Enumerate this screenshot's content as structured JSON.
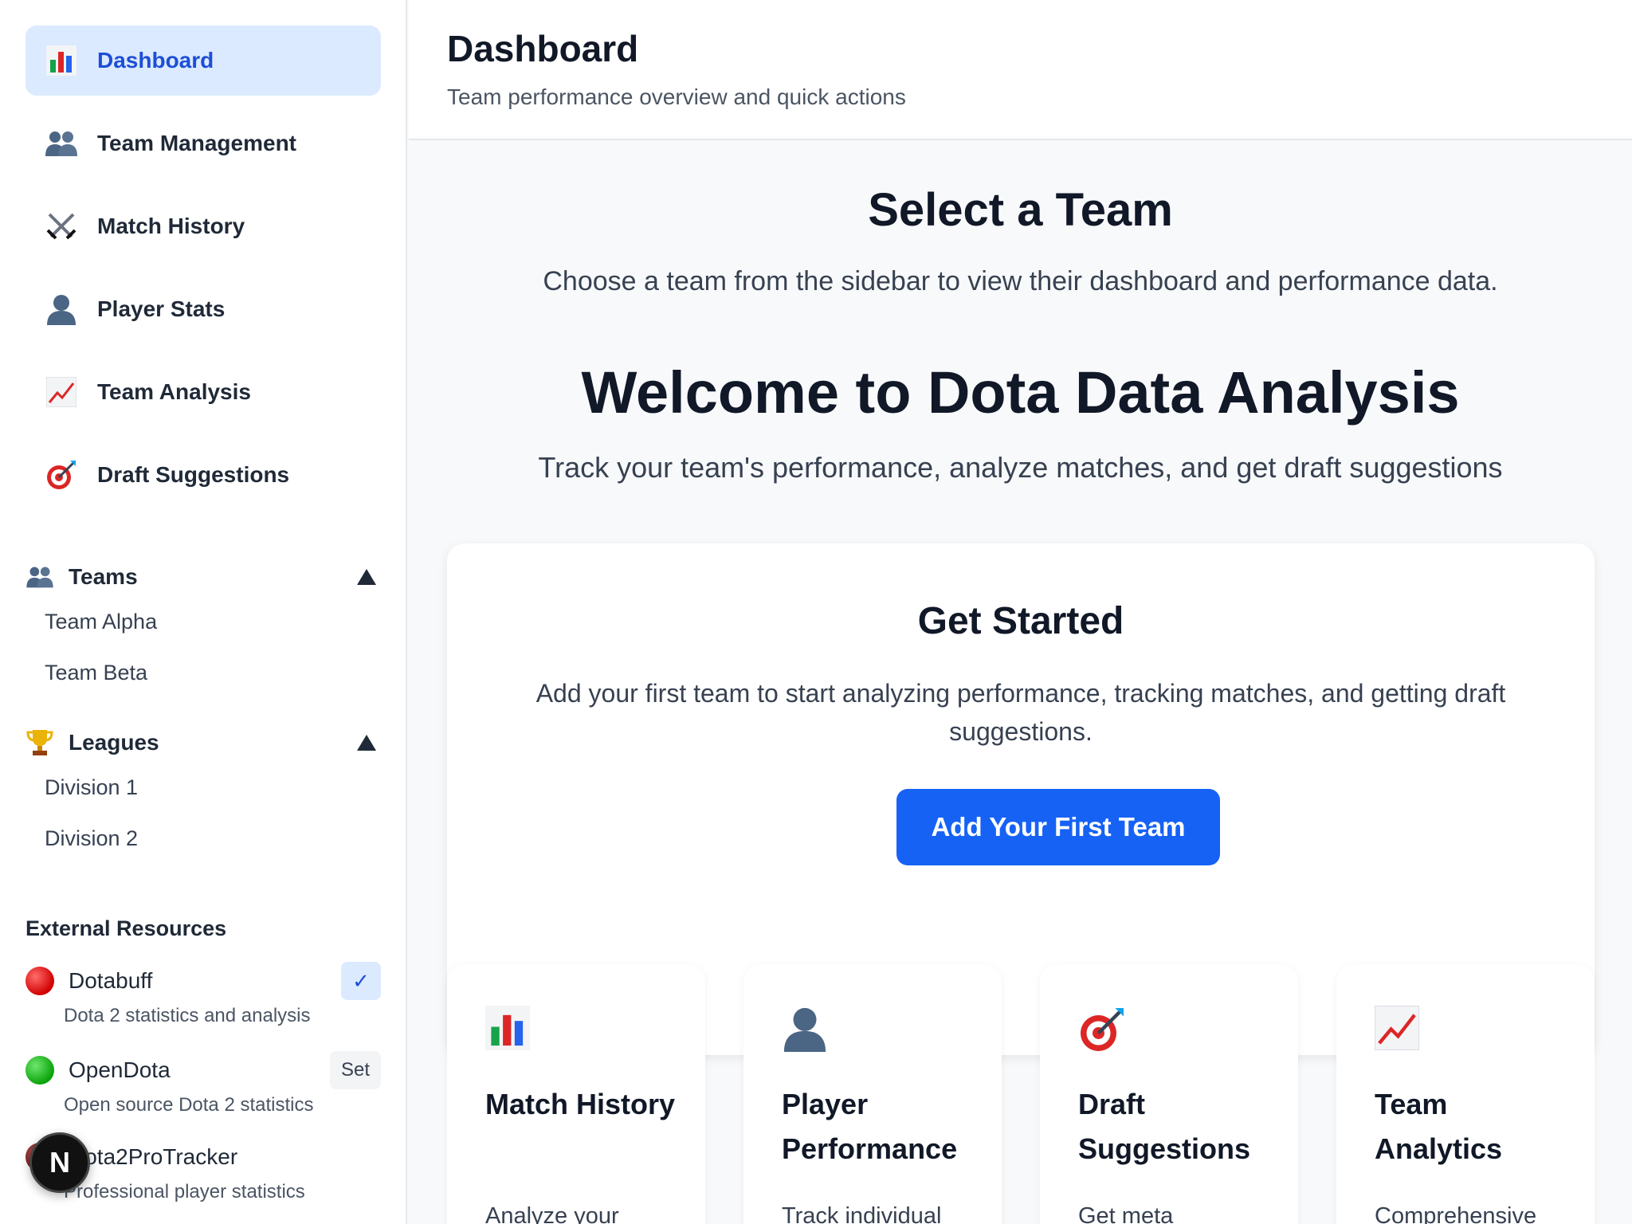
{
  "sidebar": {
    "nav": [
      {
        "label": "Dashboard",
        "icon": "bar-chart-icon",
        "active": true
      },
      {
        "label": "Team Management",
        "icon": "people-icon"
      },
      {
        "label": "Match History",
        "icon": "crossed-swords-icon"
      },
      {
        "label": "Player Stats",
        "icon": "person-icon"
      },
      {
        "label": "Team Analysis",
        "icon": "trend-chart-icon"
      },
      {
        "label": "Draft Suggestions",
        "icon": "target-icon"
      }
    ],
    "teams": {
      "label": "Teams",
      "icon": "people-icon",
      "items": [
        "Team Alpha",
        "Team Beta"
      ]
    },
    "leagues": {
      "label": "Leagues",
      "icon": "trophy-icon",
      "items": [
        "Division 1",
        "Division 2"
      ]
    },
    "external": {
      "title": "External Resources",
      "items": [
        {
          "name": "Dotabuff",
          "desc": "Dota 2 statistics and analysis",
          "button": "✓",
          "color": "#d10000"
        },
        {
          "name": "OpenDota",
          "desc": "Open source Dota 2 statistics",
          "button": "Set",
          "color": "#0aa30a"
        },
        {
          "name": "Dota2ProTracker",
          "desc": "Professional player statistics",
          "color": "#6b1515"
        }
      ]
    },
    "badge": "N"
  },
  "header": {
    "title": "Dashboard",
    "subtitle": "Team performance overview and quick actions"
  },
  "main": {
    "select_title": "Select a Team",
    "select_subtitle": "Choose a team from the sidebar to view their dashboard and performance data.",
    "welcome_title": "Welcome to Dota Data Analysis",
    "welcome_subtitle": "Track your team's performance, analyze matches, and get draft suggestions",
    "card": {
      "title": "Get Started",
      "text": "Add your first team to start analyzing performance, tracking matches, and getting draft suggestions.",
      "button": "Add Your First Team"
    },
    "features": [
      {
        "title": "Match History",
        "desc": "Analyze your",
        "icon": "bar-chart-icon"
      },
      {
        "title": "Player Performance",
        "desc": "Track individual",
        "icon": "person-icon"
      },
      {
        "title": "Draft Suggestions",
        "desc": "Get meta",
        "icon": "target-icon"
      },
      {
        "title": "Team Analytics",
        "desc": "Comprehensive",
        "icon": "trend-chart-icon"
      }
    ]
  },
  "colors": {
    "accent": "#1662f5",
    "active_bg": "#dbeafe",
    "active_text": "#1d4ed8"
  }
}
